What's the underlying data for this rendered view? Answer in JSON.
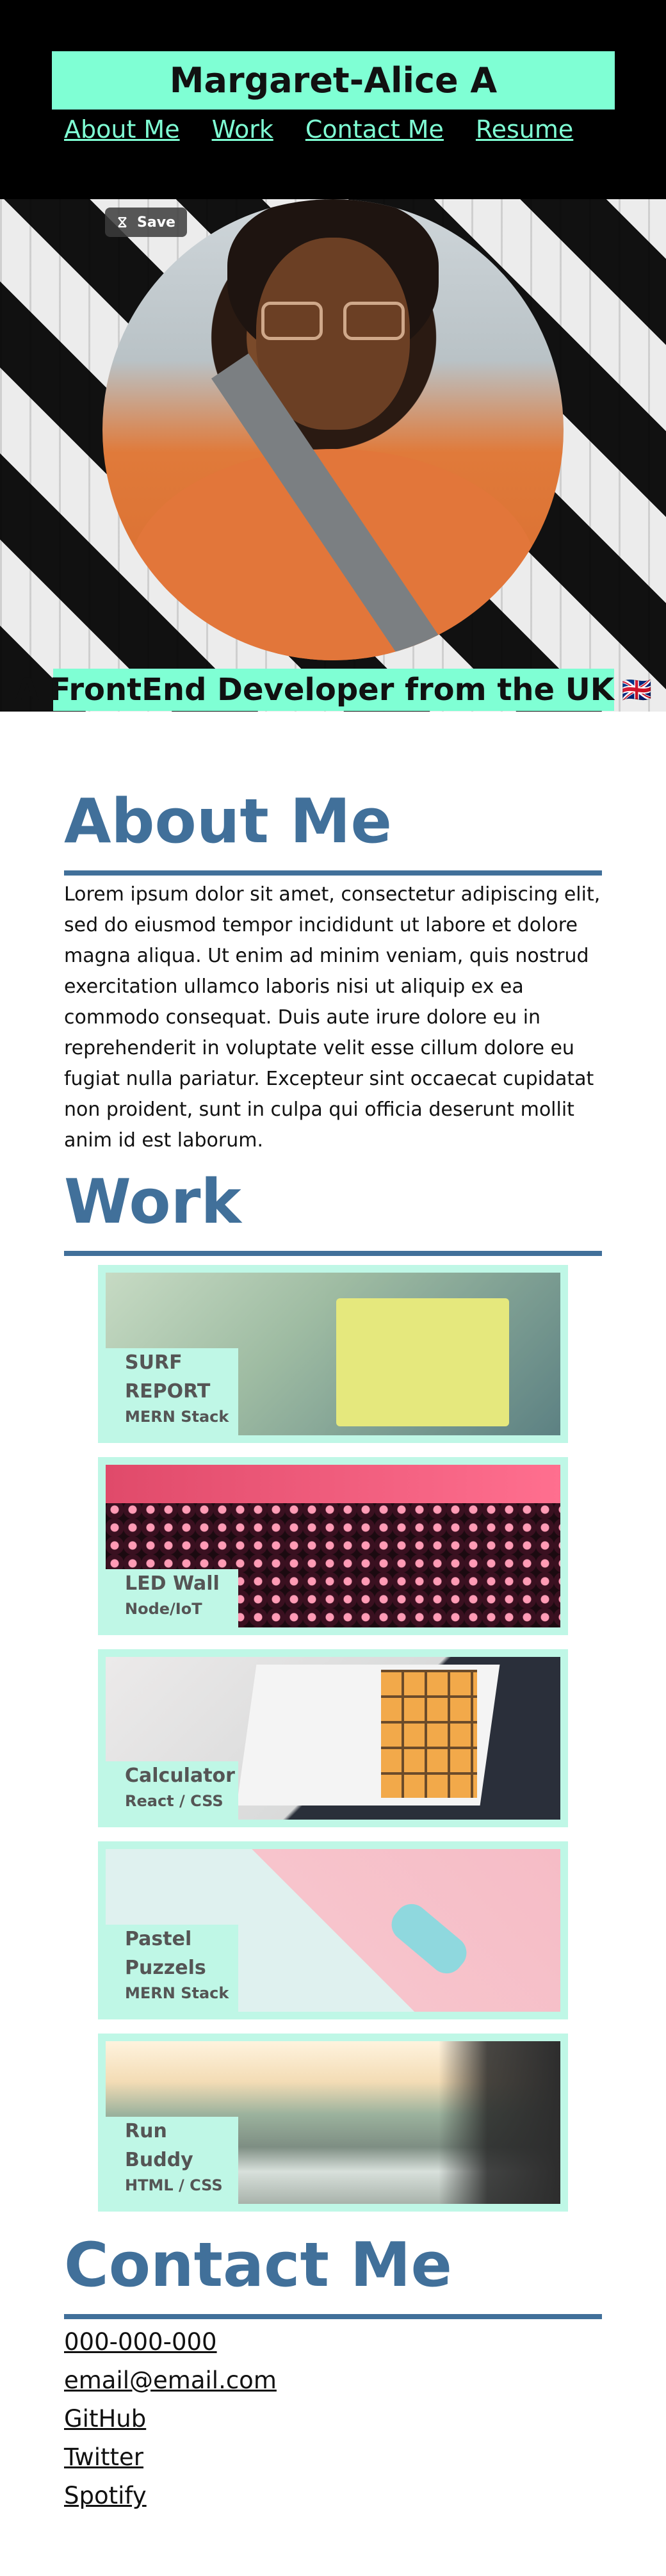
{
  "header": {
    "name": "Margaret-Alice A",
    "nav": [
      "About Me",
      "Work",
      "Contact Me",
      "Resume"
    ]
  },
  "hero": {
    "save_label": "Save",
    "tagline": "A FrontEnd Developer from the UK",
    "flag": "🇬🇧"
  },
  "about": {
    "title": "About Me",
    "body": "Lorem ipsum dolor sit amet, consectetur adipiscing elit, sed do eiusmod tempor incididunt ut labore et dolore magna aliqua. Ut enim ad minim veniam, quis nostrud exercitation ullamco laboris nisi ut aliquip ex ea commodo consequat. Duis aute irure dolore eu in reprehenderit in voluptate velit esse cillum dolore eu fugiat nulla pariatur. Excepteur sint occaecat cupidatat non proident, sunt in culpa qui officia deserunt mollit anim id est laborum."
  },
  "work": {
    "title": "Work",
    "projects": [
      {
        "title_lines": [
          "SURF",
          "REPORT"
        ],
        "stack": "MERN Stack",
        "image": "surf-report-screenshot"
      },
      {
        "title_lines": [
          "LED Wall"
        ],
        "stack": "Node/IoT",
        "image": "led-wall-photo"
      },
      {
        "title_lines": [
          "Calculator"
        ],
        "stack": "React / CSS",
        "image": "calculator-photo"
      },
      {
        "title_lines": [
          "Pastel",
          "Puzzels"
        ],
        "stack": "MERN Stack",
        "image": "pastel-car-photo"
      },
      {
        "title_lines": [
          "Run",
          "Buddy"
        ],
        "stack": "HTML / CSS",
        "image": "surfer-beach-photo"
      }
    ]
  },
  "contact": {
    "title": "Contact Me",
    "links": [
      "000-000-000",
      "email@email.com",
      "GitHub",
      "Twitter",
      "Spotify"
    ]
  },
  "colors": {
    "header_bg": "#000000",
    "accent_mint": "#7fffd4",
    "card_mint": "#bff7e6",
    "heading_blue": "#41709a"
  }
}
